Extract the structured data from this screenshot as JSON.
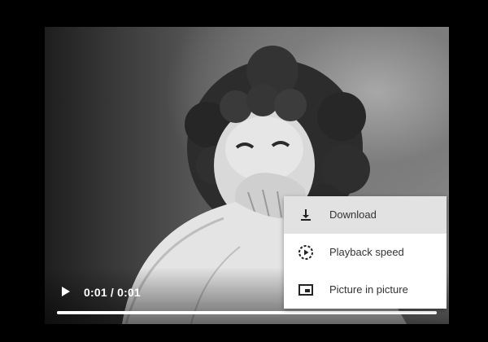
{
  "player": {
    "time_display": "0:01 / 0:01",
    "progress": 1.0,
    "play_icon": "play-icon"
  },
  "menu": {
    "items": [
      {
        "label": "Download",
        "icon": "download-icon",
        "highlighted": true
      },
      {
        "label": "Playback speed",
        "icon": "playback-speed-icon",
        "highlighted": false
      },
      {
        "label": "Picture in picture",
        "icon": "picture-in-picture-icon",
        "highlighted": false
      }
    ]
  },
  "colors": {
    "menu_background": "#ffffff",
    "menu_highlight": "#e2e2e2",
    "menu_text": "#333333",
    "controls_text": "#ffffff"
  }
}
